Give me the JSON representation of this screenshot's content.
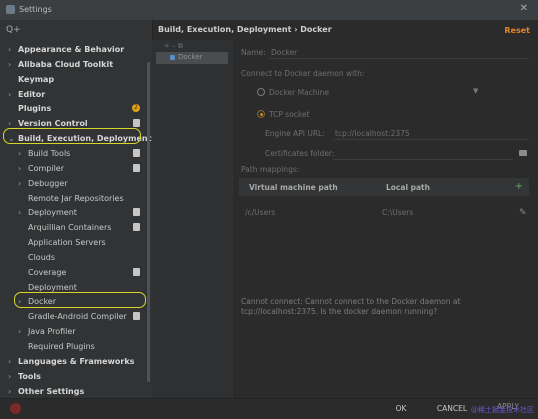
{
  "window": {
    "title": "Settings"
  },
  "search": {
    "placeholder": "Q+"
  },
  "tree": [
    {
      "label": "Appearance & Behavior",
      "arrow": "›",
      "bold": true
    },
    {
      "label": "Alibaba Cloud Toolkit",
      "arrow": "›",
      "bold": true
    },
    {
      "label": "Keymap",
      "arrow": "",
      "bold": true
    },
    {
      "label": "Editor",
      "arrow": "›",
      "bold": true
    },
    {
      "label": "Plugins",
      "arrow": "",
      "bold": true,
      "badge": "2"
    },
    {
      "label": "Version Control",
      "arrow": "›",
      "bold": true
    },
    {
      "label": "Build, Execution, Deployment",
      "arrow": "⌄",
      "bold": true
    },
    {
      "label": "Build Tools",
      "arrow": "›"
    },
    {
      "label": "Compiler",
      "arrow": "›"
    },
    {
      "label": "Debugger",
      "arrow": "›"
    },
    {
      "label": "Remote Jar Repositories",
      "arrow": ""
    },
    {
      "label": "Deployment",
      "arrow": "›"
    },
    {
      "label": "Arquillian Containers",
      "arrow": ""
    },
    {
      "label": "Application Servers",
      "arrow": ""
    },
    {
      "label": "Clouds",
      "arrow": ""
    },
    {
      "label": "Coverage",
      "arrow": ""
    },
    {
      "label": "Deployment",
      "arrow": ""
    },
    {
      "label": "Docker",
      "arrow": "›"
    },
    {
      "label": "Gradle-Android Compiler",
      "arrow": ""
    },
    {
      "label": "Java Profiler",
      "arrow": "›"
    },
    {
      "label": "Required Plugins",
      "arrow": ""
    },
    {
      "label": "Languages & Frameworks",
      "arrow": "›",
      "bold": true
    },
    {
      "label": "Tools",
      "arrow": "›",
      "bold": true
    },
    {
      "label": "Other Settings",
      "arrow": "›",
      "bold": true
    }
  ],
  "header": {
    "breadcrumb": "Build, Execution, Deployment  ›  Docker",
    "reset": "Reset"
  },
  "inner_list": {
    "toolbar": "+  –  ⧉",
    "docker_item": "Docker"
  },
  "docker": {
    "name_label": "Name:",
    "name_value": "Docker",
    "connect_label": "Connect to Docker daemon with:",
    "option_machine": "Docker Machine",
    "option_tcp": "TCP socket",
    "engine_url_label": "Engine API URL:",
    "engine_url_value": "tcp://localhost:2375",
    "certs_label": "Certificates folder:",
    "path_mappings_label": "Path mappings:",
    "col_vm_path": "Virtual machine path",
    "col_local_path": "Local path",
    "row_vm_path": "/c/Users",
    "row_local_path": "C:\\Users",
    "error": "Cannot connect: Cannot connect to the Docker daemon at tcp://localhost:2375. Is the docker daemon running?"
  },
  "footer": {
    "ok": "OK",
    "cancel": "CANCEL",
    "apply": "APPLY",
    "watermark": "@稀土掘金技术社区"
  },
  "colors": {
    "accent_orange": "#e3862f",
    "highlight_yellow": "#d6d629",
    "bg": "#2b2b2b"
  }
}
